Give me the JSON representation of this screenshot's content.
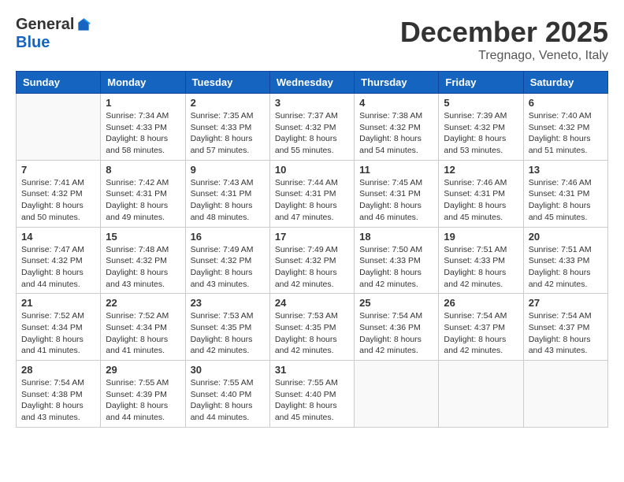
{
  "logo": {
    "general": "General",
    "blue": "Blue"
  },
  "title": "December 2025",
  "subtitle": "Tregnago, Veneto, Italy",
  "weekdays": [
    "Sunday",
    "Monday",
    "Tuesday",
    "Wednesday",
    "Thursday",
    "Friday",
    "Saturday"
  ],
  "weeks": [
    [
      {
        "day": "",
        "info": ""
      },
      {
        "day": "1",
        "info": "Sunrise: 7:34 AM\nSunset: 4:33 PM\nDaylight: 8 hours\nand 58 minutes."
      },
      {
        "day": "2",
        "info": "Sunrise: 7:35 AM\nSunset: 4:33 PM\nDaylight: 8 hours\nand 57 minutes."
      },
      {
        "day": "3",
        "info": "Sunrise: 7:37 AM\nSunset: 4:32 PM\nDaylight: 8 hours\nand 55 minutes."
      },
      {
        "day": "4",
        "info": "Sunrise: 7:38 AM\nSunset: 4:32 PM\nDaylight: 8 hours\nand 54 minutes."
      },
      {
        "day": "5",
        "info": "Sunrise: 7:39 AM\nSunset: 4:32 PM\nDaylight: 8 hours\nand 53 minutes."
      },
      {
        "day": "6",
        "info": "Sunrise: 7:40 AM\nSunset: 4:32 PM\nDaylight: 8 hours\nand 51 minutes."
      }
    ],
    [
      {
        "day": "7",
        "info": "Sunrise: 7:41 AM\nSunset: 4:32 PM\nDaylight: 8 hours\nand 50 minutes."
      },
      {
        "day": "8",
        "info": "Sunrise: 7:42 AM\nSunset: 4:31 PM\nDaylight: 8 hours\nand 49 minutes."
      },
      {
        "day": "9",
        "info": "Sunrise: 7:43 AM\nSunset: 4:31 PM\nDaylight: 8 hours\nand 48 minutes."
      },
      {
        "day": "10",
        "info": "Sunrise: 7:44 AM\nSunset: 4:31 PM\nDaylight: 8 hours\nand 47 minutes."
      },
      {
        "day": "11",
        "info": "Sunrise: 7:45 AM\nSunset: 4:31 PM\nDaylight: 8 hours\nand 46 minutes."
      },
      {
        "day": "12",
        "info": "Sunrise: 7:46 AM\nSunset: 4:31 PM\nDaylight: 8 hours\nand 45 minutes."
      },
      {
        "day": "13",
        "info": "Sunrise: 7:46 AM\nSunset: 4:31 PM\nDaylight: 8 hours\nand 45 minutes."
      }
    ],
    [
      {
        "day": "14",
        "info": "Sunrise: 7:47 AM\nSunset: 4:32 PM\nDaylight: 8 hours\nand 44 minutes."
      },
      {
        "day": "15",
        "info": "Sunrise: 7:48 AM\nSunset: 4:32 PM\nDaylight: 8 hours\nand 43 minutes."
      },
      {
        "day": "16",
        "info": "Sunrise: 7:49 AM\nSunset: 4:32 PM\nDaylight: 8 hours\nand 43 minutes."
      },
      {
        "day": "17",
        "info": "Sunrise: 7:49 AM\nSunset: 4:32 PM\nDaylight: 8 hours\nand 42 minutes."
      },
      {
        "day": "18",
        "info": "Sunrise: 7:50 AM\nSunset: 4:33 PM\nDaylight: 8 hours\nand 42 minutes."
      },
      {
        "day": "19",
        "info": "Sunrise: 7:51 AM\nSunset: 4:33 PM\nDaylight: 8 hours\nand 42 minutes."
      },
      {
        "day": "20",
        "info": "Sunrise: 7:51 AM\nSunset: 4:33 PM\nDaylight: 8 hours\nand 42 minutes."
      }
    ],
    [
      {
        "day": "21",
        "info": "Sunrise: 7:52 AM\nSunset: 4:34 PM\nDaylight: 8 hours\nand 41 minutes."
      },
      {
        "day": "22",
        "info": "Sunrise: 7:52 AM\nSunset: 4:34 PM\nDaylight: 8 hours\nand 41 minutes."
      },
      {
        "day": "23",
        "info": "Sunrise: 7:53 AM\nSunset: 4:35 PM\nDaylight: 8 hours\nand 42 minutes."
      },
      {
        "day": "24",
        "info": "Sunrise: 7:53 AM\nSunset: 4:35 PM\nDaylight: 8 hours\nand 42 minutes."
      },
      {
        "day": "25",
        "info": "Sunrise: 7:54 AM\nSunset: 4:36 PM\nDaylight: 8 hours\nand 42 minutes."
      },
      {
        "day": "26",
        "info": "Sunrise: 7:54 AM\nSunset: 4:37 PM\nDaylight: 8 hours\nand 42 minutes."
      },
      {
        "day": "27",
        "info": "Sunrise: 7:54 AM\nSunset: 4:37 PM\nDaylight: 8 hours\nand 43 minutes."
      }
    ],
    [
      {
        "day": "28",
        "info": "Sunrise: 7:54 AM\nSunset: 4:38 PM\nDaylight: 8 hours\nand 43 minutes."
      },
      {
        "day": "29",
        "info": "Sunrise: 7:55 AM\nSunset: 4:39 PM\nDaylight: 8 hours\nand 44 minutes."
      },
      {
        "day": "30",
        "info": "Sunrise: 7:55 AM\nSunset: 4:40 PM\nDaylight: 8 hours\nand 44 minutes."
      },
      {
        "day": "31",
        "info": "Sunrise: 7:55 AM\nSunset: 4:40 PM\nDaylight: 8 hours\nand 45 minutes."
      },
      {
        "day": "",
        "info": ""
      },
      {
        "day": "",
        "info": ""
      },
      {
        "day": "",
        "info": ""
      }
    ]
  ]
}
